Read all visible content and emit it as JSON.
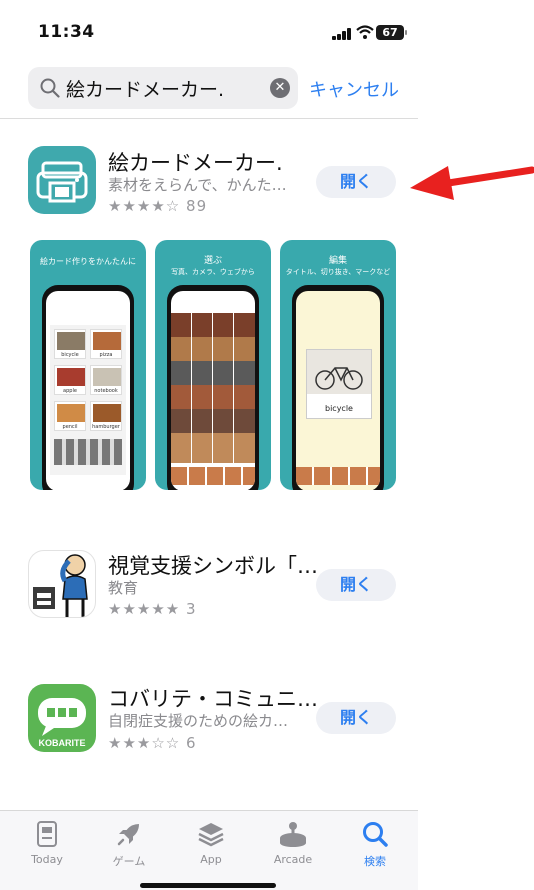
{
  "status": {
    "time": "11:34",
    "battery": "67"
  },
  "search": {
    "query": "絵カードメーカー.",
    "cancel_label": "キャンセル"
  },
  "results": [
    {
      "title": "絵カードメーカー.",
      "subtitle": "素材をえらんで、かんた…",
      "stars": "★★★★☆",
      "rating_count": "89",
      "open_label": "開く"
    },
    {
      "title": "視覚支援シンボル「…",
      "subtitle": "教育",
      "stars": "★★★★★",
      "rating_count": "3",
      "open_label": "開く"
    },
    {
      "title": "コバリテ・コミュニ…",
      "subtitle": "自閉症支援のための絵カ…",
      "stars": "★★★☆☆",
      "rating_count": "6",
      "open_label": "開く",
      "icon_text": "KOBARITE"
    }
  ],
  "screenshots": [
    {
      "caption": "絵カード作りをかんたんに",
      "cells": [
        "bicycle",
        "pizza",
        "apple",
        "notebook",
        "pencil",
        "hamburger"
      ]
    },
    {
      "caption": "選ぶ",
      "caption2": "写真、カメラ、ウェブから"
    },
    {
      "caption": "編集",
      "caption2": "タイトル、切り抜き、マークなど",
      "card_word": "bicycle"
    }
  ],
  "tabs": [
    {
      "label": "Today",
      "icon": "today-icon"
    },
    {
      "label": "ゲーム",
      "icon": "games-rocket-icon"
    },
    {
      "label": "App",
      "icon": "apps-stack-icon"
    },
    {
      "label": "Arcade",
      "icon": "arcade-joystick-icon"
    },
    {
      "label": "検索",
      "icon": "search-icon",
      "active": true
    }
  ],
  "colors": {
    "accent": "#2d7ff0",
    "teal": "#39a9ad",
    "kobarite_green": "#5bb553",
    "arrow": "#e8211f"
  }
}
